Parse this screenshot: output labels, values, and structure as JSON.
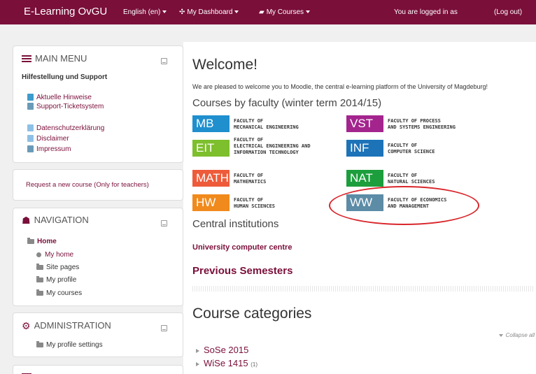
{
  "topbar": {
    "brand": "E-Learning OvGU",
    "language": "English (en)",
    "dashboard": "My Dashboard",
    "courses": "My Courses",
    "logged_in": "You are logged in as",
    "logout": "(Log out)"
  },
  "main_menu": {
    "title": "MAIN MENU",
    "subtitle": "Hilfestellung und Support",
    "items": [
      "Aktuelle Hinweise",
      "Support-Ticketsystem",
      "Datenschutzerklärung",
      "Disclaimer",
      "Impressum"
    ]
  },
  "request_block": {
    "link": "Request a new course (Only for teachers)"
  },
  "navigation": {
    "title": "NAVIGATION",
    "home": "Home",
    "items": [
      "My home",
      "Site pages",
      "My profile",
      "My courses"
    ]
  },
  "administration": {
    "title": "ADMINISTRATION",
    "items": [
      "My profile settings"
    ]
  },
  "main": {
    "welcome": "Welcome!",
    "intro": "We are pleased to welcome you to Moodle, the central e-learning platform of the University of Magdeburg!",
    "faculty_heading": "Courses by faculty (winter term 2014/15)",
    "faculties": [
      {
        "abbr": "MB",
        "color": "#1f8fce",
        "line1": "FACULTY OF",
        "line2": "MECHANICAL ENGINEERING",
        "line3": ""
      },
      {
        "abbr": "VST",
        "color": "#a4248e",
        "line1": "FACULTY OF PROCESS",
        "line2": "AND SYSTEMS ENGINEERING",
        "line3": ""
      },
      {
        "abbr": "EIT",
        "color": "#7dbf2c",
        "line1": "FACULTY OF",
        "line2": "ELECTRICAL ENGINEERING AND",
        "line3": "INFORMATION TECHNOLOGY"
      },
      {
        "abbr": "INF",
        "color": "#1d73b8",
        "line1": "FACULTY OF",
        "line2": "COMPUTER SCIENCE",
        "line3": ""
      },
      {
        "abbr": "MATH",
        "color": "#ee5b3a",
        "line1": "FACULTY OF",
        "line2": "MATHEMATICS",
        "line3": ""
      },
      {
        "abbr": "NAT",
        "color": "#1c9e3c",
        "line1": "FACULTY OF",
        "line2": "NATURAL SCIENCES",
        "line3": ""
      },
      {
        "abbr": "HW",
        "color": "#f18a1c",
        "line1": "FACULTY OF",
        "line2": "HUMAN SCIENCES",
        "line3": ""
      },
      {
        "abbr": "WW",
        "color": "#5c8ca6",
        "line1": "FACULTY OF ECONOMICS",
        "line2": "AND MANAGEMENT",
        "line3": ""
      }
    ],
    "central_heading": "Central institutions",
    "computer_centre": "University computer centre",
    "previous": "Previous Semesters",
    "categories_heading": "Course categories",
    "collapse_all": "Collapse all",
    "categories": [
      {
        "name": "SoSe 2015",
        "count": ""
      },
      {
        "name": "WiSe 1415",
        "count": "(1)"
      }
    ]
  },
  "annotation_color": "#d9262b"
}
